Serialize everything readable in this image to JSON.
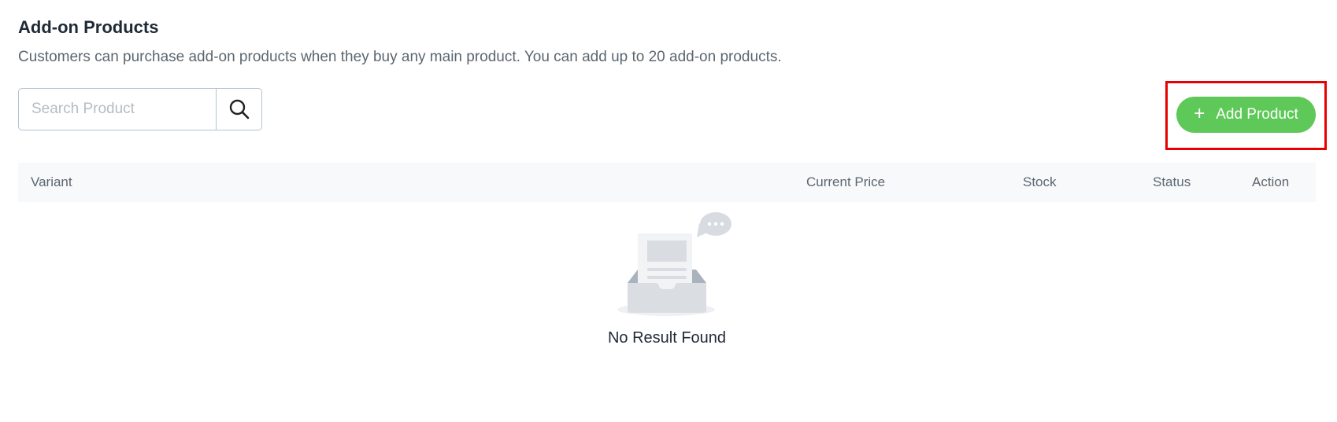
{
  "section": {
    "title": "Add-on Products",
    "description": "Customers can purchase add-on products when they buy any main product. You can add up to 20 add-on products."
  },
  "search": {
    "placeholder": "Search Product",
    "value": "",
    "icon": "search-icon"
  },
  "add_button": {
    "icon": "plus-icon",
    "plus_glyph": "+",
    "label": "Add Product"
  },
  "table": {
    "columns": [
      "Variant",
      "Current Price",
      "Stock",
      "Status",
      "Action"
    ]
  },
  "empty_state": {
    "icon": "empty-inbox-icon",
    "text": "No Result Found"
  },
  "colors": {
    "accent_green": "#5ec958",
    "highlight_red": "#e60000",
    "header_bg": "#f8f9fa",
    "text_dark": "#1f2a36",
    "text_muted": "#5b6670"
  }
}
